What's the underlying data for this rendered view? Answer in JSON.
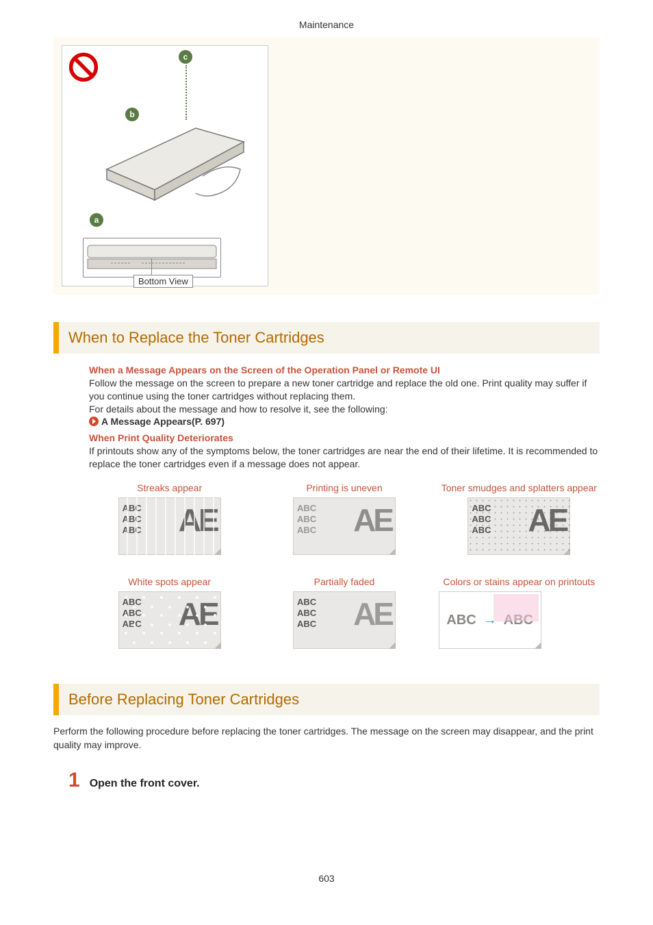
{
  "header": {
    "title": "Maintenance"
  },
  "figure": {
    "callouts": {
      "a": "a",
      "b": "b",
      "c": "c"
    },
    "bottom_view_label": "Bottom View"
  },
  "section1": {
    "heading": "When to Replace the Toner Cartridges",
    "sub1_title": "When a Message Appears on the Screen of the Operation Panel or Remote UI",
    "sub1_body1": "Follow the message on the screen to prepare a new toner cartridge and replace the old one. Print quality may suffer if you continue using the toner cartridges without replacing them.",
    "sub1_body2": "For details about the message and how to resolve it, see the following:",
    "sub1_link": "A Message Appears(P. 697)",
    "sub2_title": "When Print Quality Deteriorates",
    "sub2_body": "If printouts show any of the symptoms below, the toner cartridges are near the end of their lifetime. It is recommended to replace the toner cartridges even if a message does not appear."
  },
  "symptoms": [
    {
      "label": "Streaks appear"
    },
    {
      "label": "Printing is uneven"
    },
    {
      "label": "Toner smudges and splatters appear"
    },
    {
      "label": "White spots appear"
    },
    {
      "label": "Partially faded"
    },
    {
      "label": "Colors or stains appear on printouts"
    }
  ],
  "thumb_text": {
    "abc_lines": "ABC\nABC\nABC",
    "big": "AE",
    "colors_left": "ABC",
    "colors_right": "ABC",
    "arrow": "→"
  },
  "section2": {
    "heading": "Before Replacing Toner Cartridges",
    "intro": "Perform the following procedure before replacing the toner cartridges. The message on the screen may disappear, and the print quality may improve.",
    "step1_num": "1",
    "step1_text": "Open the front cover."
  },
  "footer": {
    "page_number": "603"
  }
}
